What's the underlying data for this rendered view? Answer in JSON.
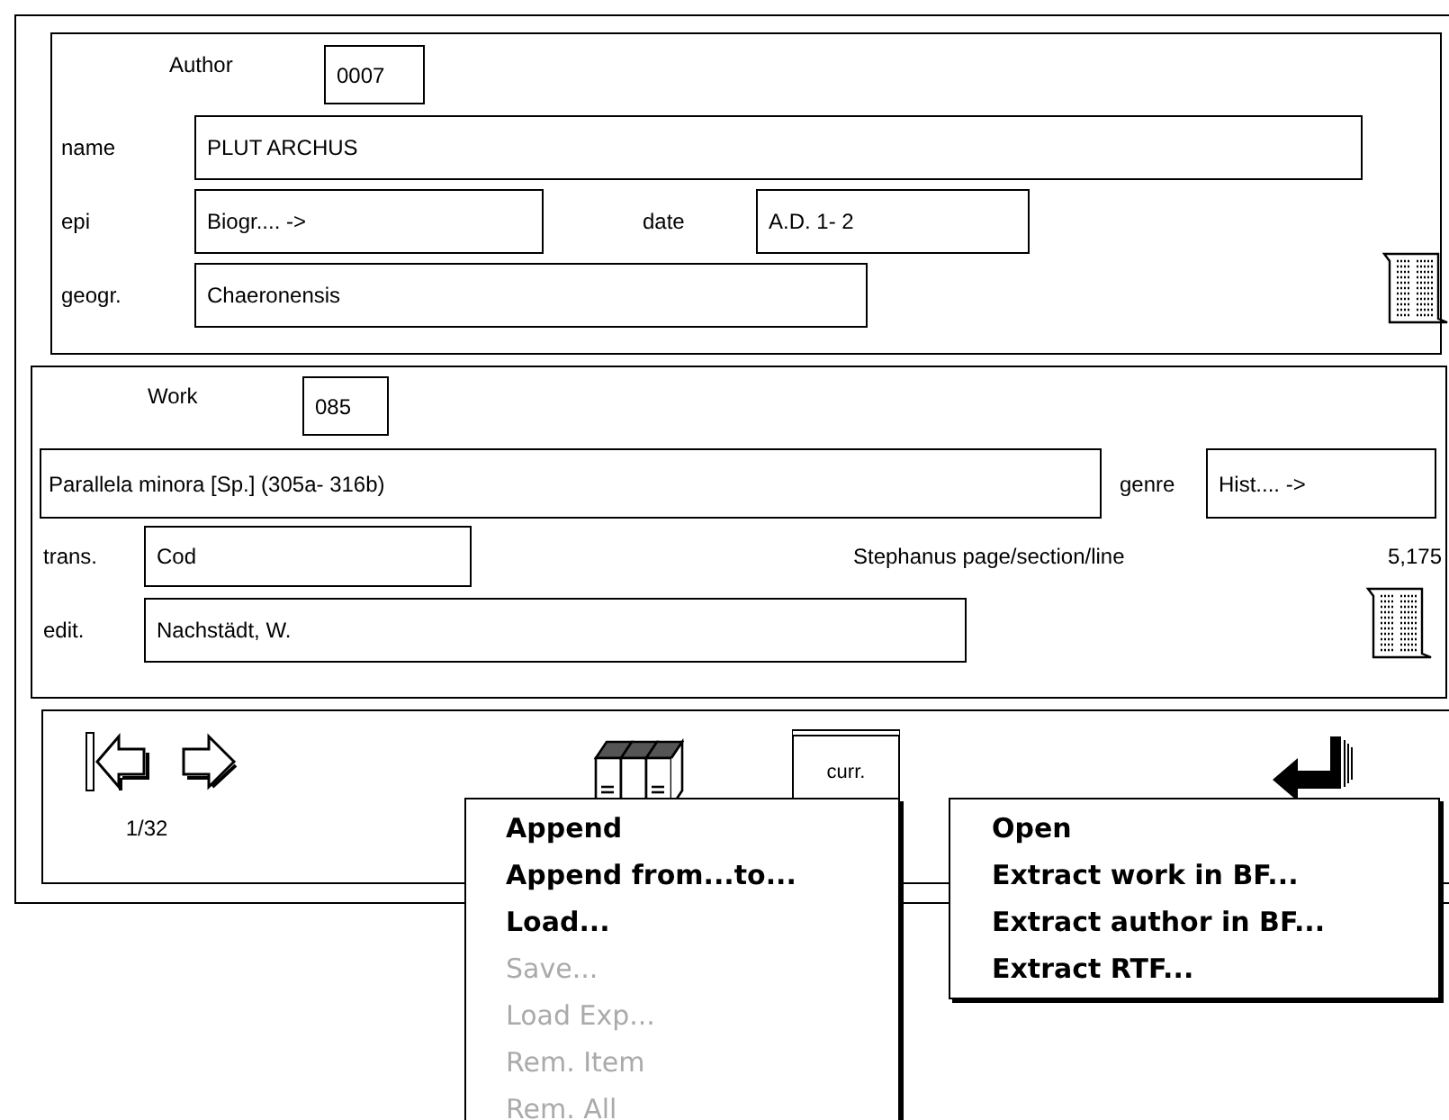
{
  "author": {
    "label": "Author",
    "number": "0007",
    "name": {
      "label": "name",
      "value": "PLUT ARCHUS"
    },
    "epi": {
      "label": "epi",
      "value": "Biogr.... ->"
    },
    "date": {
      "label": "date",
      "value": "A.D. 1- 2"
    },
    "geogr": {
      "label": "geogr.",
      "value": "Chaeronensis"
    }
  },
  "work": {
    "label": "Work",
    "number": "085",
    "title": {
      "value": "Parallela minora [Sp.] (305a- 316b)"
    },
    "genre": {
      "label": "genre",
      "value": "Hist.... ->"
    },
    "trans": {
      "label": "trans.",
      "value": "Cod"
    },
    "stephanus": {
      "label": "Stephanus page/section/line",
      "value": "5,175"
    },
    "edit": {
      "label": "edit.",
      "value": "Nachstädt, W."
    }
  },
  "nav": {
    "counter": "1/32",
    "current_label": "curr."
  },
  "menus": [
    {
      "items": [
        {
          "label": "Append",
          "disabled": false
        },
        {
          "label": "Append from...to...",
          "disabled": false
        },
        {
          "label": "Load...",
          "disabled": false
        },
        {
          "label": "Save...",
          "disabled": true
        },
        {
          "label": "Load Exp...",
          "disabled": true
        },
        {
          "label": "Rem. Item",
          "disabled": true
        },
        {
          "label": "Rem. All",
          "disabled": true
        }
      ]
    },
    {
      "items": [
        {
          "label": "Open",
          "disabled": false
        },
        {
          "label": "Extract work in BF...",
          "disabled": false
        },
        {
          "label": "Extract author in BF...",
          "disabled": false
        },
        {
          "label": "Extract RTF...",
          "disabled": false
        }
      ]
    }
  ]
}
